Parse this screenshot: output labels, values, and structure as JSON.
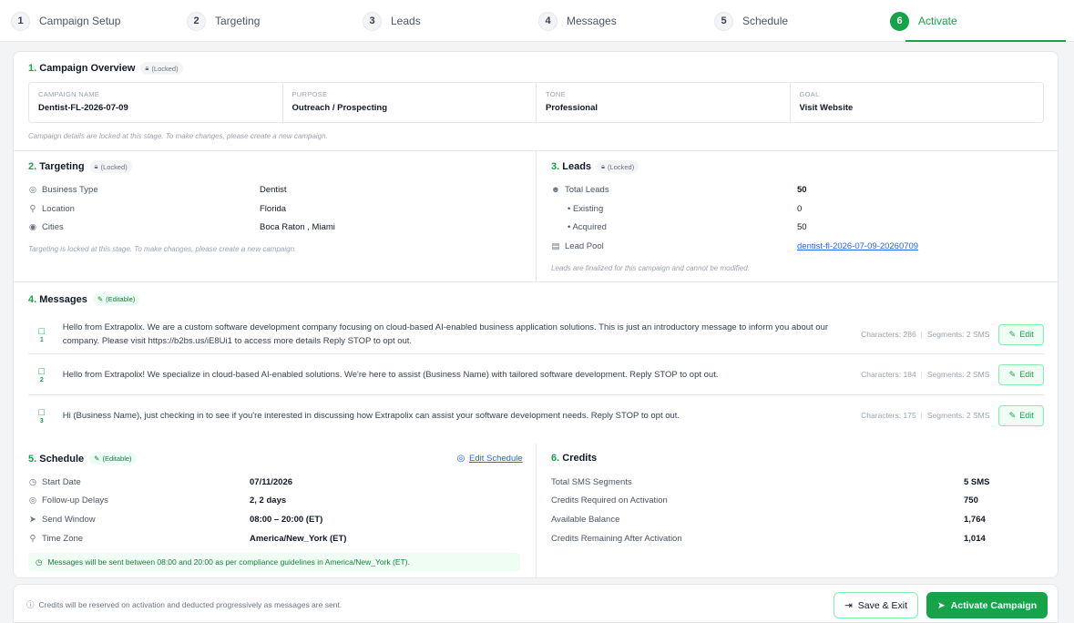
{
  "stepper": [
    {
      "num": "1",
      "label": "Campaign Setup"
    },
    {
      "num": "2",
      "label": "Targeting"
    },
    {
      "num": "3",
      "label": "Leads"
    },
    {
      "num": "4",
      "label": "Messages"
    },
    {
      "num": "5",
      "label": "Schedule"
    },
    {
      "num": "6",
      "label": "Activate"
    }
  ],
  "overview": {
    "num": "1.",
    "title": "Campaign Overview",
    "badge": "(Locked)",
    "fields": [
      {
        "label": "CAMPAIGN NAME",
        "value": "Dentist-FL-2026-07-09"
      },
      {
        "label": "PURPOSE",
        "value": "Outreach / Prospecting"
      },
      {
        "label": "TONE",
        "value": "Professional"
      },
      {
        "label": "GOAL",
        "value": "Visit Website"
      }
    ],
    "note": "Campaign details are locked at this stage. To make changes, please create a new campaign."
  },
  "targeting": {
    "num": "2.",
    "title": "Targeting",
    "badge": "(Locked)",
    "rows": [
      {
        "label": "Business Type",
        "value": "Dentist"
      },
      {
        "label": "Location",
        "value": "Florida"
      },
      {
        "label": "Cities",
        "value": "Boca Raton , Miami"
      }
    ],
    "note": "Targeting is locked at this stage. To make changes, please create a new campaign."
  },
  "leads": {
    "num": "3.",
    "title": "Leads",
    "badge": "(Locked)",
    "total_label": "Total Leads",
    "total_value": "50",
    "existing_label": "• Existing",
    "existing_value": "0",
    "acquired_label": "• Acquired",
    "acquired_value": "50",
    "pool_label": "Lead Pool",
    "pool_value": "dentist-fl-2026-07-09-20260709",
    "note": "Leads are finalized for this campaign and cannot be modified."
  },
  "messages": {
    "num": "4.",
    "title": "Messages",
    "badge": "(Editable)",
    "edit_label": "Edit",
    "chars_label": "Characters:",
    "segments_label": "Segments:",
    "items": [
      {
        "index": "1",
        "text": "Hello from Extrapolix. We are a custom software development company focusing on cloud-based AI-enabled business application solutions. This is just an introductory message to inform you about our company. Please visit https://b2bs.us/iE8Ui1 to access more details Reply STOP to opt out.",
        "chars": "286",
        "segments": "2 SMS"
      },
      {
        "index": "2",
        "text": "Hello from Extrapolix! We specialize in cloud-based AI-enabled solutions. We're here to assist (Business Name) with tailored software development. Reply STOP to opt out.",
        "chars": "184",
        "segments": "2 SMS"
      },
      {
        "index": "3",
        "text": "Hi (Business Name), just checking in to see if you're interested in discussing how Extrapolix can assist your software development needs. Reply STOP to opt out.",
        "chars": "175",
        "segments": "2 SMS"
      }
    ]
  },
  "schedule": {
    "num": "5.",
    "title": "Schedule",
    "badge": "(Editable)",
    "edit_link": "Edit Schedule",
    "rows": [
      {
        "label": "Start Date",
        "value": "07/11/2026"
      },
      {
        "label": "Follow-up Delays",
        "value": "2, 2 days"
      },
      {
        "label": "Send Window",
        "value": "08:00 – 20:00 (ET)"
      },
      {
        "label": "Time Zone",
        "value": "America/New_York (ET)"
      }
    ],
    "note": "Messages will be sent between 08:00 and 20:00 as per compliance guidelines in America/New_York (ET)."
  },
  "credits": {
    "num": "6.",
    "title": "Credits",
    "rows": [
      {
        "label": "Total SMS Segments",
        "value": "5 SMS"
      },
      {
        "label": "Credits Required on Activation",
        "value": "750"
      },
      {
        "label": "Available Balance",
        "value": "1,764"
      },
      {
        "label": "Credits Remaining After Activation",
        "value": "1,014"
      }
    ]
  },
  "footer": {
    "note": "Credits will be reserved on activation and deducted progressively as messages are sent.",
    "save_label": "Save & Exit",
    "activate_label": "Activate Campaign"
  },
  "colors": {
    "accent": "#16a34a",
    "link": "#2563eb"
  }
}
